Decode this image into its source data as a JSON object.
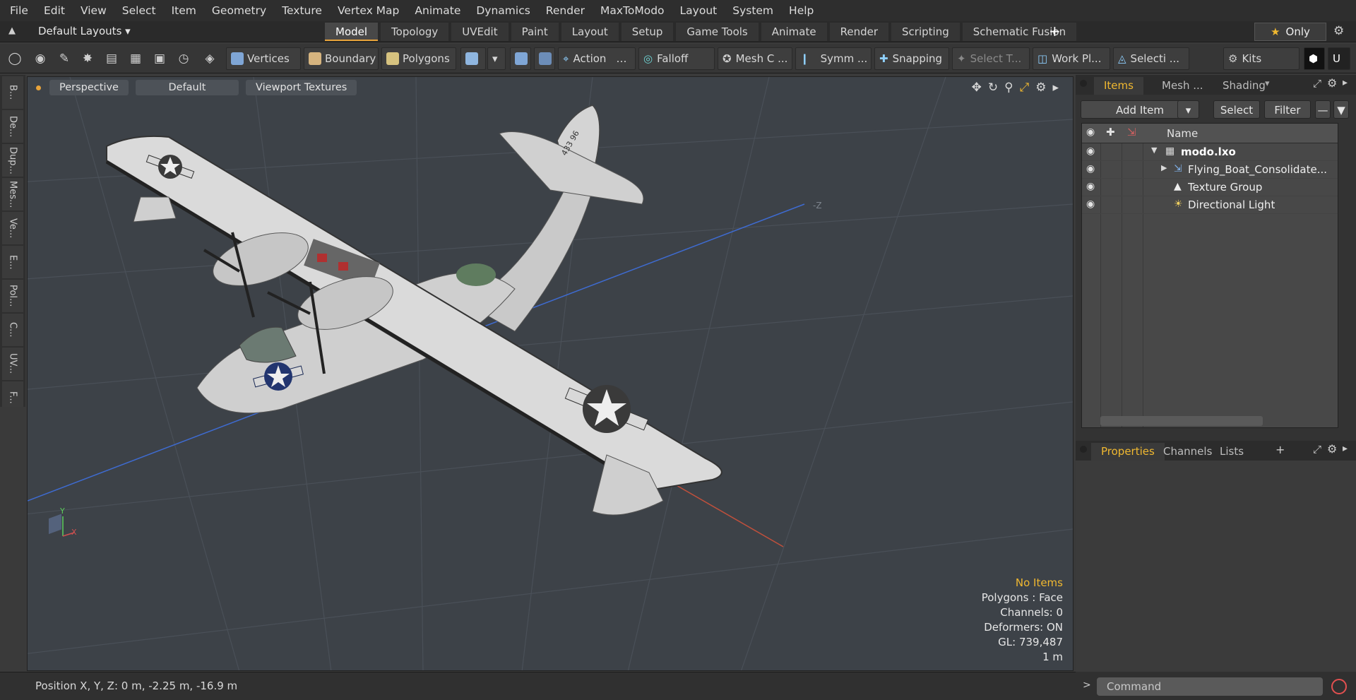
{
  "menubar": {
    "items": [
      "File",
      "Edit",
      "View",
      "Select",
      "Item",
      "Geometry",
      "Texture",
      "Vertex Map",
      "Animate",
      "Dynamics",
      "Render",
      "MaxToModo",
      "Layout",
      "System",
      "Help"
    ]
  },
  "layoutbar": {
    "layout_select": "Default Layouts ▾",
    "tabs": [
      "Model",
      "Topology",
      "UVEdit",
      "Paint",
      "Layout",
      "Setup",
      "Game Tools",
      "Animate",
      "Render",
      "Scripting",
      "Schematic Fusion"
    ],
    "active_tab": "Model",
    "only_label": "Only"
  },
  "toolbar": {
    "vertices": "Vertices",
    "boundary": "Boundary",
    "polygons": "Polygons",
    "action": "Action",
    "falloff": "Falloff",
    "mesh": "Mesh C ...",
    "symm": "Symm ...",
    "snapping": "Snapping",
    "select_t": "Select T...",
    "work_plane": "Work Pl...",
    "selecti": "Selecti ...",
    "kits": "Kits"
  },
  "leftstrip": {
    "tabs": [
      "B...",
      "De...",
      "Dup...",
      "Mes...",
      "Ve...",
      "E...",
      "Pol...",
      "C...",
      "UV...",
      "F..."
    ]
  },
  "viewport": {
    "perspective": "Perspective",
    "default": "Default",
    "textures": "Viewport Textures",
    "tail_number": "433 96",
    "axis_label": "-Z",
    "info": {
      "no_items": "No Items",
      "polygons": "Polygons : Face",
      "channels": "Channels: 0",
      "deformers": "Deformers: ON",
      "gl": "GL: 739,487",
      "scale": "1 m"
    },
    "gizmo": {
      "y": "Y",
      "x": "X"
    }
  },
  "status": {
    "position": "Position X, Y, Z:   0 m, -2.25 m, -16.9 m"
  },
  "items_panel": {
    "tabs": [
      "Items",
      "Mesh ...",
      "Shading"
    ],
    "active_tab": "Items",
    "add_item": "Add Item",
    "select": "Select",
    "filter": "Filter",
    "name_col": "Name",
    "rows": [
      {
        "label": "modo.lxo"
      },
      {
        "label": "Flying_Boat_Consolidate..."
      },
      {
        "label": "Texture Group"
      },
      {
        "label": "Directional Light"
      }
    ]
  },
  "properties_panel": {
    "tabs": [
      "Properties",
      "Channels",
      "Lists"
    ],
    "active_tab": "Properties",
    "add": "+"
  },
  "command": {
    "placeholder": "Command"
  },
  "colors": {
    "accent": "#e8a33a",
    "viewport_bg": "#3d4248",
    "star": "#f0b830"
  }
}
